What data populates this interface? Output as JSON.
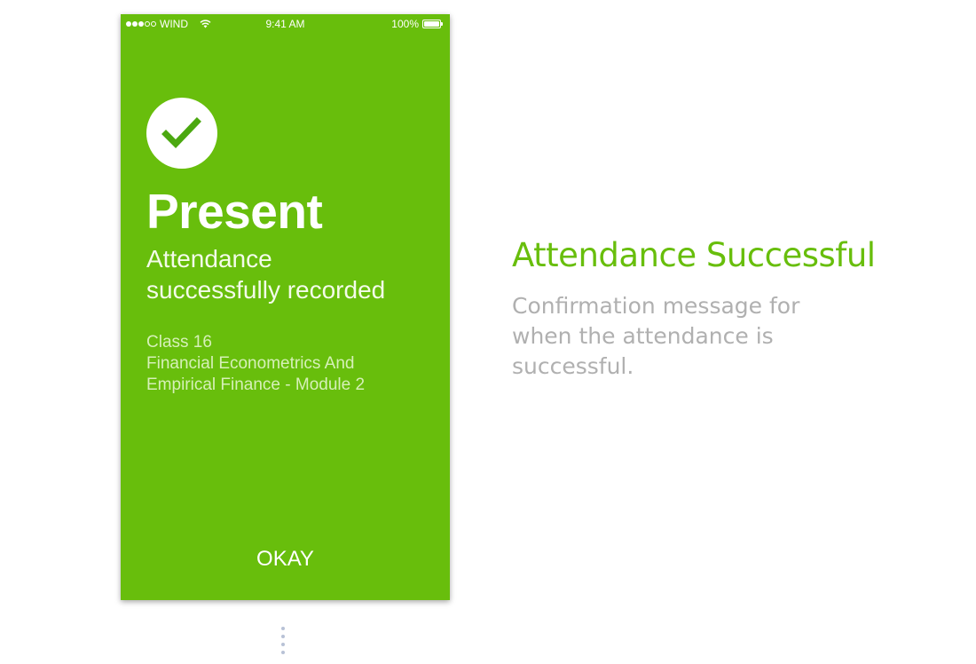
{
  "status_bar": {
    "carrier": "WIND",
    "time": "9:41 AM",
    "battery": "100%",
    "signal_bars_filled": 3,
    "signal_bars_total": 5
  },
  "screen": {
    "background_color": "#68be0c",
    "icon": "checkmark-icon",
    "title": "Present",
    "subtitle_line1": "Attendance",
    "subtitle_line2": "successfully recorded",
    "class_line": "Class 16",
    "course_line1": "Financial Econometrics And",
    "course_line2": "Empirical Finance - Module 2",
    "okay_label": "OKAY"
  },
  "description": {
    "title": "Attendance Successful",
    "text_line1": "Confirmation message for",
    "text_line2": "when the attendance is",
    "text_line3": "successful.",
    "accent_color": "#68be0c",
    "text_color": "#b0b0b0"
  }
}
